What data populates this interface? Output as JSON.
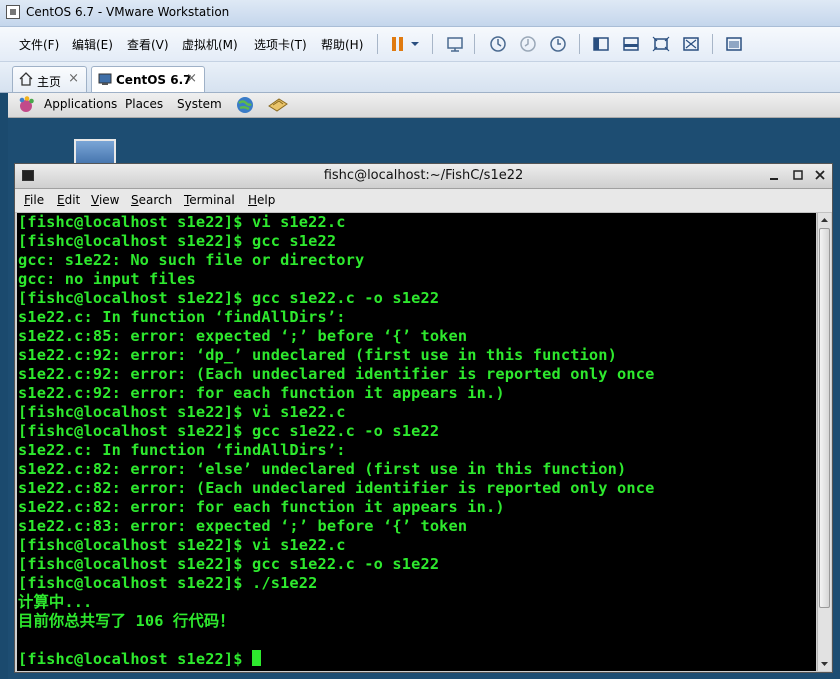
{
  "vmware": {
    "title": "CentOS 6.7 - VMware Workstation",
    "menu": [
      "文件(F)",
      "编辑(E)",
      "查看(V)",
      "虚拟机(M)",
      "选项卡(T)",
      "帮助(H)"
    ],
    "tabs": [
      {
        "label": "主页",
        "icon": "home-icon"
      },
      {
        "label": "CentOS 6.7",
        "icon": "vm-icon",
        "active": true
      }
    ],
    "close_glyph": "×"
  },
  "gnome_panel": {
    "applications": "Applications",
    "places": "Places",
    "system": "System"
  },
  "terminal": {
    "title": "fishc@localhost:~/FishC/s1e22",
    "menu": [
      "File",
      "Edit",
      "View",
      "Search",
      "Terminal",
      "Help"
    ],
    "lines": [
      "[fishc@localhost s1e22]$ vi s1e22.c",
      "[fishc@localhost s1e22]$ gcc s1e22",
      "gcc: s1e22: No such file or directory",
      "gcc: no input files",
      "[fishc@localhost s1e22]$ gcc s1e22.c -o s1e22",
      "s1e22.c: In function ‘findAllDirs’:",
      "s1e22.c:85: error: expected ‘;’ before ‘{’ token",
      "s1e22.c:92: error: ‘dp_’ undeclared (first use in this function)",
      "s1e22.c:92: error: (Each undeclared identifier is reported only once",
      "s1e22.c:92: error: for each function it appears in.)",
      "[fishc@localhost s1e22]$ vi s1e22.c",
      "[fishc@localhost s1e22]$ gcc s1e22.c -o s1e22",
      "s1e22.c: In function ‘findAllDirs’:",
      "s1e22.c:82: error: ‘else’ undeclared (first use in this function)",
      "s1e22.c:82: error: (Each undeclared identifier is reported only once",
      "s1e22.c:82: error: for each function it appears in.)",
      "s1e22.c:83: error: expected ‘;’ before ‘{’ token",
      "[fishc@localhost s1e22]$ vi s1e22.c",
      "[fishc@localhost s1e22]$ gcc s1e22.c -o s1e22",
      "[fishc@localhost s1e22]$ ./s1e22",
      "计算中...",
      "目前你总共写了 106 行代码！",
      "",
      "[fishc@localhost s1e22]$ "
    ],
    "colors": {
      "text": "#2ee92e",
      "background": "#000000"
    }
  }
}
